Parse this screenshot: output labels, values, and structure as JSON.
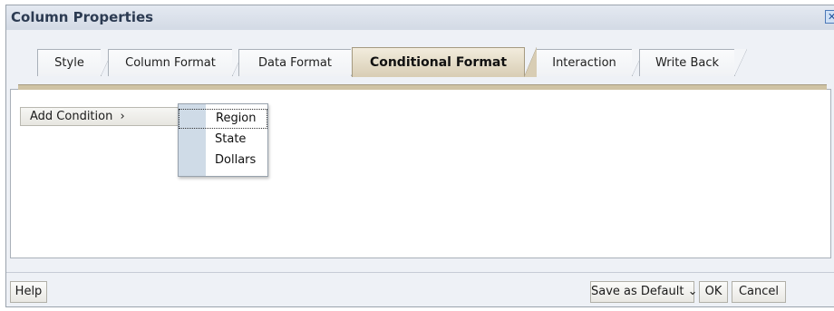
{
  "dialog": {
    "title": "Column Properties",
    "close_glyph": "✕"
  },
  "tabs": [
    {
      "label": "Style",
      "active": false
    },
    {
      "label": "Column Format",
      "active": false
    },
    {
      "label": "Data Format",
      "active": false
    },
    {
      "label": "Conditional Format",
      "active": true
    },
    {
      "label": "Interaction",
      "active": false
    },
    {
      "label": "Write Back",
      "active": false
    }
  ],
  "content": {
    "add_condition_label": "Add Condition",
    "add_condition_arrow": "›",
    "menu": {
      "items": [
        "Region",
        "State",
        "Dollars"
      ],
      "focused_item": "Region"
    }
  },
  "footer": {
    "help_label": "Help",
    "save_default_label": "Save as Default",
    "save_default_arrow": "⌄",
    "ok_label": "OK",
    "cancel_label": "Cancel"
  },
  "colors": {
    "active_tab": "#d8cdb4",
    "menu_gutter": "#cfdbe7",
    "title_text": "#2c3b52"
  }
}
